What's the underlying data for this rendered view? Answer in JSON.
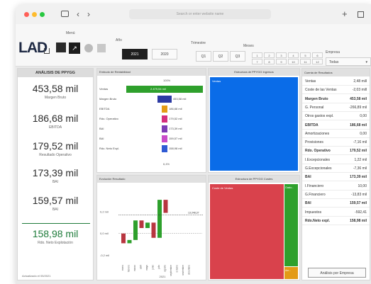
{
  "browser": {
    "address": "Search or enter website name",
    "colors": {
      "close": "#ff5f57",
      "min": "#febc2e",
      "max": "#28c840"
    }
  },
  "ribbon": {
    "logo": "LAD",
    "menu_label": "Menú",
    "year_label": "Año",
    "years": [
      "2021",
      "2020"
    ],
    "quarter_label": "Trimestre",
    "quarters": [
      "Q1",
      "Q2",
      "Q3",
      "Q4"
    ],
    "month_label": "Meses",
    "months": [
      "1",
      "2",
      "3",
      "4",
      "5",
      "6",
      "7",
      "8",
      "9",
      "10",
      "11",
      "12"
    ],
    "company_label": "Empresa",
    "company_value": "Todas"
  },
  "kpis": {
    "title": "ANÁLISIS DE PPYGG",
    "items": [
      {
        "value": "453,58 mil",
        "label": "Margen Bruto"
      },
      {
        "value": "186,68 mil",
        "label": "EBITDA"
      },
      {
        "value": "179,52 mil",
        "label": "Resultado Operativo"
      },
      {
        "value": "173,39 mil",
        "label": "BAI"
      },
      {
        "value": "159,57 mil",
        "label": "BAI"
      },
      {
        "value": "158,98 mil",
        "label": "Rdo. Neto Explotación"
      }
    ],
    "footer": "Actualizado el 05/2021",
    "accent": "#1e7b3a"
  },
  "funnel": {
    "title": "Embudo de Rentabilidad",
    "top_pct": "100%",
    "bottom_pct": "6,4%",
    "rows": [
      {
        "label": "Ventas",
        "value": "2.479,54 mil",
        "pct": 1.0,
        "color": "#2ea02c"
      },
      {
        "label": "Margen Bruto",
        "value": "453,58 mil",
        "pct": 0.183,
        "color": "#2c3aa3"
      },
      {
        "label": "EBITDA",
        "value": "186,68 mil",
        "pct": 0.075,
        "color": "#e39b16"
      },
      {
        "label": "Rdo. Operativo",
        "value": "179,52 mil",
        "pct": 0.072,
        "color": "#d42e7c"
      },
      {
        "label": "BAI",
        "value": "173,39 mil",
        "pct": 0.07,
        "color": "#7d3cb5"
      },
      {
        "label": "BAI",
        "value": "159,57 mil",
        "pct": 0.064,
        "color": "#c94cc9"
      },
      {
        "label": "Rdo. Neto Expl.",
        "value": "158,98 mil",
        "pct": 0.064,
        "color": "#2f5bd4"
      }
    ]
  },
  "waterfall": {
    "title": "Evolución Resultado",
    "y_ticks": [
      "0,2 mil",
      "0,0 mil",
      "-0,2 mil"
    ],
    "ref_label": "13.248,37",
    "x_label": "2021",
    "months": [
      "enero",
      "febrero",
      "marzo",
      "abril",
      "mayo",
      "junio",
      "julio",
      "agosto",
      "septiembre",
      "octubre",
      "noviembre",
      "diciembre"
    ],
    "values": [
      -0.09,
      0.03,
      0.18,
      -0.07,
      0.05,
      -0.14,
      0.35,
      -0.12,
      0,
      0,
      0,
      0
    ],
    "pos_color": "#2ea02c",
    "neg_color": "#b83640"
  },
  "treemap_income": {
    "title": "Estructura de PPYGG Ingresos",
    "label": "Ventas",
    "color": "#0a6ce8"
  },
  "treemap_costs": {
    "title": "Estructura de PPYGG Costes",
    "labels": [
      "Coste de Ventas",
      "Gasto...",
      "Am..."
    ],
    "colors": [
      "#d9424c",
      "#2ea02c",
      "#e39b16"
    ]
  },
  "pl_table": {
    "header": "Cuenta de Resultados",
    "rows": [
      {
        "name": "Ventas",
        "value": "2,48 mill",
        "bold": false
      },
      {
        "name": "Coste de las Ventas",
        "value": "-2,03 mill",
        "bold": false
      },
      {
        "name": "Margen Bruto",
        "value": "453,58 mil",
        "bold": true
      },
      {
        "name": "G. Personal",
        "value": "-266,89 mil",
        "bold": false
      },
      {
        "name": "Otros gastos expl.",
        "value": "0,00",
        "bold": false
      },
      {
        "name": "EBITDA",
        "value": "186,68 mil",
        "bold": true
      },
      {
        "name": "Amortizaciones",
        "value": "0,00",
        "bold": false
      },
      {
        "name": "Provisiones",
        "value": "-7,16 mil",
        "bold": false
      },
      {
        "name": "Rdo. Operativo",
        "value": "179,52 mil",
        "bold": true
      },
      {
        "name": "I.Excepcionales",
        "value": "1,22 mil",
        "bold": false
      },
      {
        "name": "G.Excepcionales",
        "value": "-7,36 mil",
        "bold": false
      },
      {
        "name": "BAI",
        "value": "173,39 mil",
        "bold": true
      },
      {
        "name": "I.Financiero",
        "value": "10,00",
        "bold": false
      },
      {
        "name": "G.Financiero",
        "value": "-13,83 mil",
        "bold": false
      },
      {
        "name": "BAI",
        "value": "159,57 mil",
        "bold": true
      },
      {
        "name": "Impuestos",
        "value": "-592,41",
        "bold": false
      },
      {
        "name": "Rdo.Neto expl.",
        "value": "158,98 mil",
        "bold": true
      }
    ],
    "button": "Análisis por Empresa"
  }
}
